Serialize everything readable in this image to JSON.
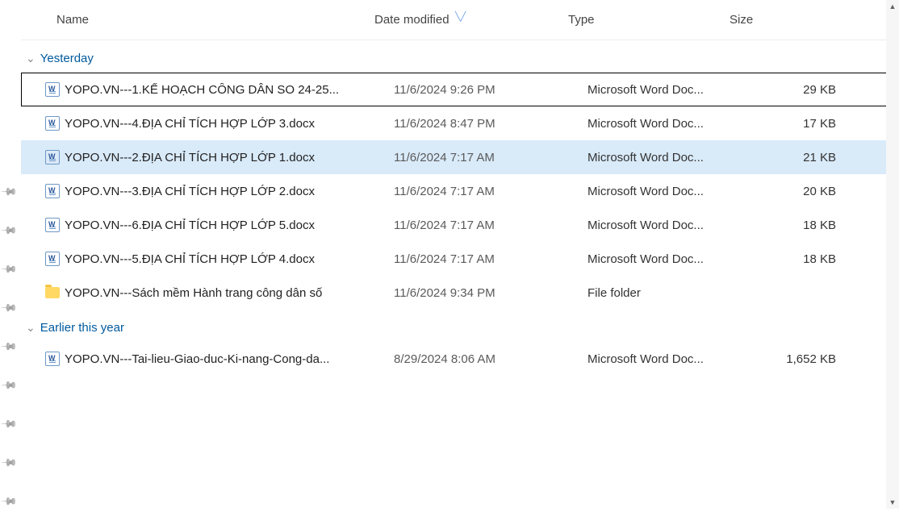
{
  "columns": {
    "name": "Name",
    "date": "Date modified",
    "type": "Type",
    "size": "Size"
  },
  "groups": [
    {
      "label": "Yesterday",
      "items": [
        {
          "icon": "word",
          "name": "YOPO.VN---1.KẾ HOẠCH CÔNG DÂN SO 24-25...",
          "date": "11/6/2024 9:26 PM",
          "type": "Microsoft Word Doc...",
          "size": "29 KB",
          "focused": true
        },
        {
          "icon": "word",
          "name": "YOPO.VN---4.ĐỊA CHỈ TÍCH HỢP LỚP 3.docx",
          "date": "11/6/2024 8:47 PM",
          "type": "Microsoft Word Doc...",
          "size": "17 KB"
        },
        {
          "icon": "word",
          "name": "YOPO.VN---2.ĐỊA CHỈ TÍCH HỢP LỚP 1.docx",
          "date": "11/6/2024 7:17 AM",
          "type": "Microsoft Word Doc...",
          "size": "21 KB",
          "selected": true
        },
        {
          "icon": "word",
          "name": "YOPO.VN---3.ĐỊA CHỈ TÍCH HỢP LỚP 2.docx",
          "date": "11/6/2024 7:17 AM",
          "type": "Microsoft Word Doc...",
          "size": "20 KB"
        },
        {
          "icon": "word",
          "name": "YOPO.VN---6.ĐỊA CHỈ TÍCH HỢP LỚP 5.docx",
          "date": "11/6/2024 7:17 AM",
          "type": "Microsoft Word Doc...",
          "size": "18 KB"
        },
        {
          "icon": "word",
          "name": "YOPO.VN---5.ĐỊA CHỈ TÍCH HỢP LỚP 4.docx",
          "date": "11/6/2024 7:17 AM",
          "type": "Microsoft Word Doc...",
          "size": "18 KB"
        },
        {
          "icon": "folder",
          "name": "YOPO.VN---Sách mềm Hành trang công dân số",
          "date": "11/6/2024 9:34 PM",
          "type": "File folder",
          "size": ""
        }
      ]
    },
    {
      "label": "Earlier this year",
      "items": [
        {
          "icon": "word",
          "name": "YOPO.VN---Tai-lieu-Giao-duc-Ki-nang-Cong-da...",
          "date": "8/29/2024 8:06 AM",
          "type": "Microsoft Word Doc...",
          "size": "1,652 KB"
        }
      ]
    }
  ],
  "pin_count": 9
}
